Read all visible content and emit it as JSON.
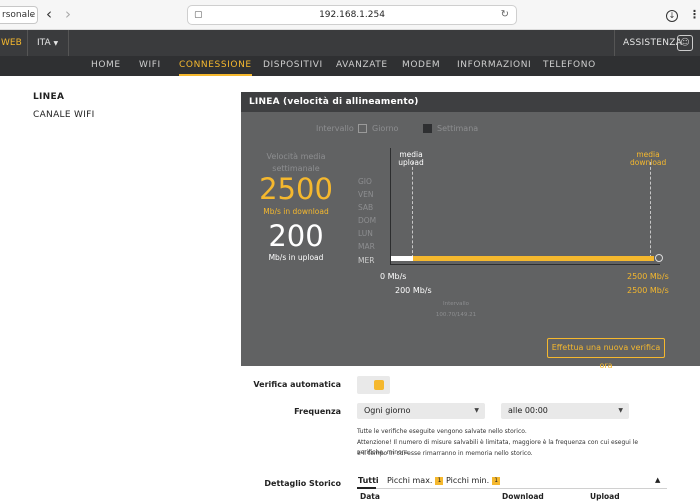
{
  "browser": {
    "profile_label": "rsonale",
    "url": "192.168.1.254",
    "back_icon": "chevron-left-icon",
    "forward_icon": "chevron-right-icon",
    "lock_icon": "page-icon",
    "reload_icon": "reload-icon",
    "download_icon": "download-icon",
    "menu_icon": "more-icon"
  },
  "topbar": {
    "brand": "WEB",
    "language": "ITA",
    "assist": "ASSISTENZA",
    "assist_icon": "chat-icon"
  },
  "nav": {
    "items": [
      "HOME",
      "WIFI",
      "CONNESSIONE",
      "DISPOSITIVI",
      "AVANZATE",
      "MODEM",
      "INFORMAZIONI",
      "TELEFONO"
    ],
    "active": "CONNESSIONE"
  },
  "sidebar": {
    "items": [
      "LINEA",
      "CANALE WIFI"
    ],
    "active": "LINEA"
  },
  "panel": {
    "title": "LINEA (velocità di allineamento)",
    "interval_label": "Intervallo",
    "interval_options": [
      {
        "label": "Giorno",
        "checked": false
      },
      {
        "label": "Settimana",
        "checked": true
      }
    ],
    "stat_label_line1": "Velocità media",
    "stat_label_line2": "settimanale",
    "download_value": "2500",
    "download_unit": "Mb/s in download",
    "upload_value": "200",
    "upload_unit": "Mb/s in upload",
    "verify_button": "Effettua una nuova verifica ora"
  },
  "chart_data": {
    "type": "bar",
    "categories": [
      "GIO",
      "VEN",
      "SAB",
      "DOM",
      "LUN",
      "MAR",
      "MER"
    ],
    "upload_marker": "media upload",
    "download_marker": "media download",
    "series": [
      {
        "name": "upload",
        "values": [
          null,
          null,
          null,
          null,
          null,
          null,
          200
        ],
        "color": "#ffffff"
      },
      {
        "name": "download",
        "values": [
          null,
          null,
          null,
          null,
          null,
          null,
          2500
        ],
        "color": "#f5b82e"
      }
    ],
    "upload_ticks": [
      "0 Mb/s",
      "200 Mb/s"
    ],
    "download_ticks": [
      "2500 Mb/s",
      "2500 Mb/s"
    ],
    "meta_line1": "Intervallo",
    "meta_line2": "100.70/149.21",
    "ylim_upload": [
      0,
      200
    ],
    "ylim_download": [
      0,
      2500
    ]
  },
  "settings": {
    "auto_verify_label": "Verifica automatica",
    "auto_verify_on": true,
    "frequency_label": "Frequenza",
    "frequency_value": "Ogni giorno",
    "time_value": "alle 00:00",
    "note_line1": "Tutte le verifiche eseguite vengono salvate nello storico.",
    "note_line2": "Attenzione! Il numero di misure salvabili è limitata, maggiore è la frequenza con cui esegui le verifiche, minore",
    "note_line3": "è il tempo in cui esse rimarranno in memoria nello storico."
  },
  "history": {
    "label": "Dettaglio Storico",
    "tabs": [
      {
        "label": "Tutti",
        "badge": ""
      },
      {
        "label": "Picchi max.",
        "badge": "1"
      },
      {
        "label": "Picchi min.",
        "badge": "1"
      }
    ],
    "columns": [
      "Data",
      "Download",
      "Upload"
    ]
  },
  "colors": {
    "accent": "#f5b82e",
    "panel_bg": "#616263",
    "header_bg": "#3a3b3d"
  }
}
